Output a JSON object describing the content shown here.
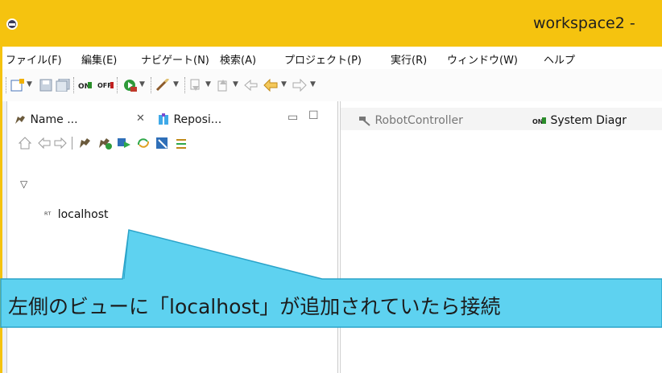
{
  "window": {
    "title": "workspace2 -"
  },
  "menu": [
    {
      "label": "ファイル(F)"
    },
    {
      "label": "編集(E)"
    },
    {
      "label": "ナビゲート(N)"
    },
    {
      "label": "検索(A)"
    },
    {
      "label": "プロジェクト(P)"
    },
    {
      "label": "実行(R)"
    },
    {
      "label": "ウィンドウ(W)"
    },
    {
      "label": "ヘルプ"
    }
  ],
  "left_view": {
    "tabs": [
      {
        "label": "Name ...",
        "icon": "plug-icon",
        "active": true
      },
      {
        "label": "Reposi...",
        "icon": "repository-icon",
        "active": false
      }
    ],
    "tree": {
      "item_prefix": "ᴿᵀ",
      "item_label": "localhost"
    }
  },
  "editor": {
    "tabs": [
      {
        "label": "RobotController",
        "icon": "hammer-icon"
      },
      {
        "label": "System Diagr",
        "icon": "on-icon"
      }
    ]
  },
  "callout": {
    "text": "左側のビューに「localhost」が追加されていたら接続",
    "fill": "#5ed2f0",
    "stroke": "#2aa3c9"
  },
  "colors": {
    "frame": "#f5c30f"
  }
}
